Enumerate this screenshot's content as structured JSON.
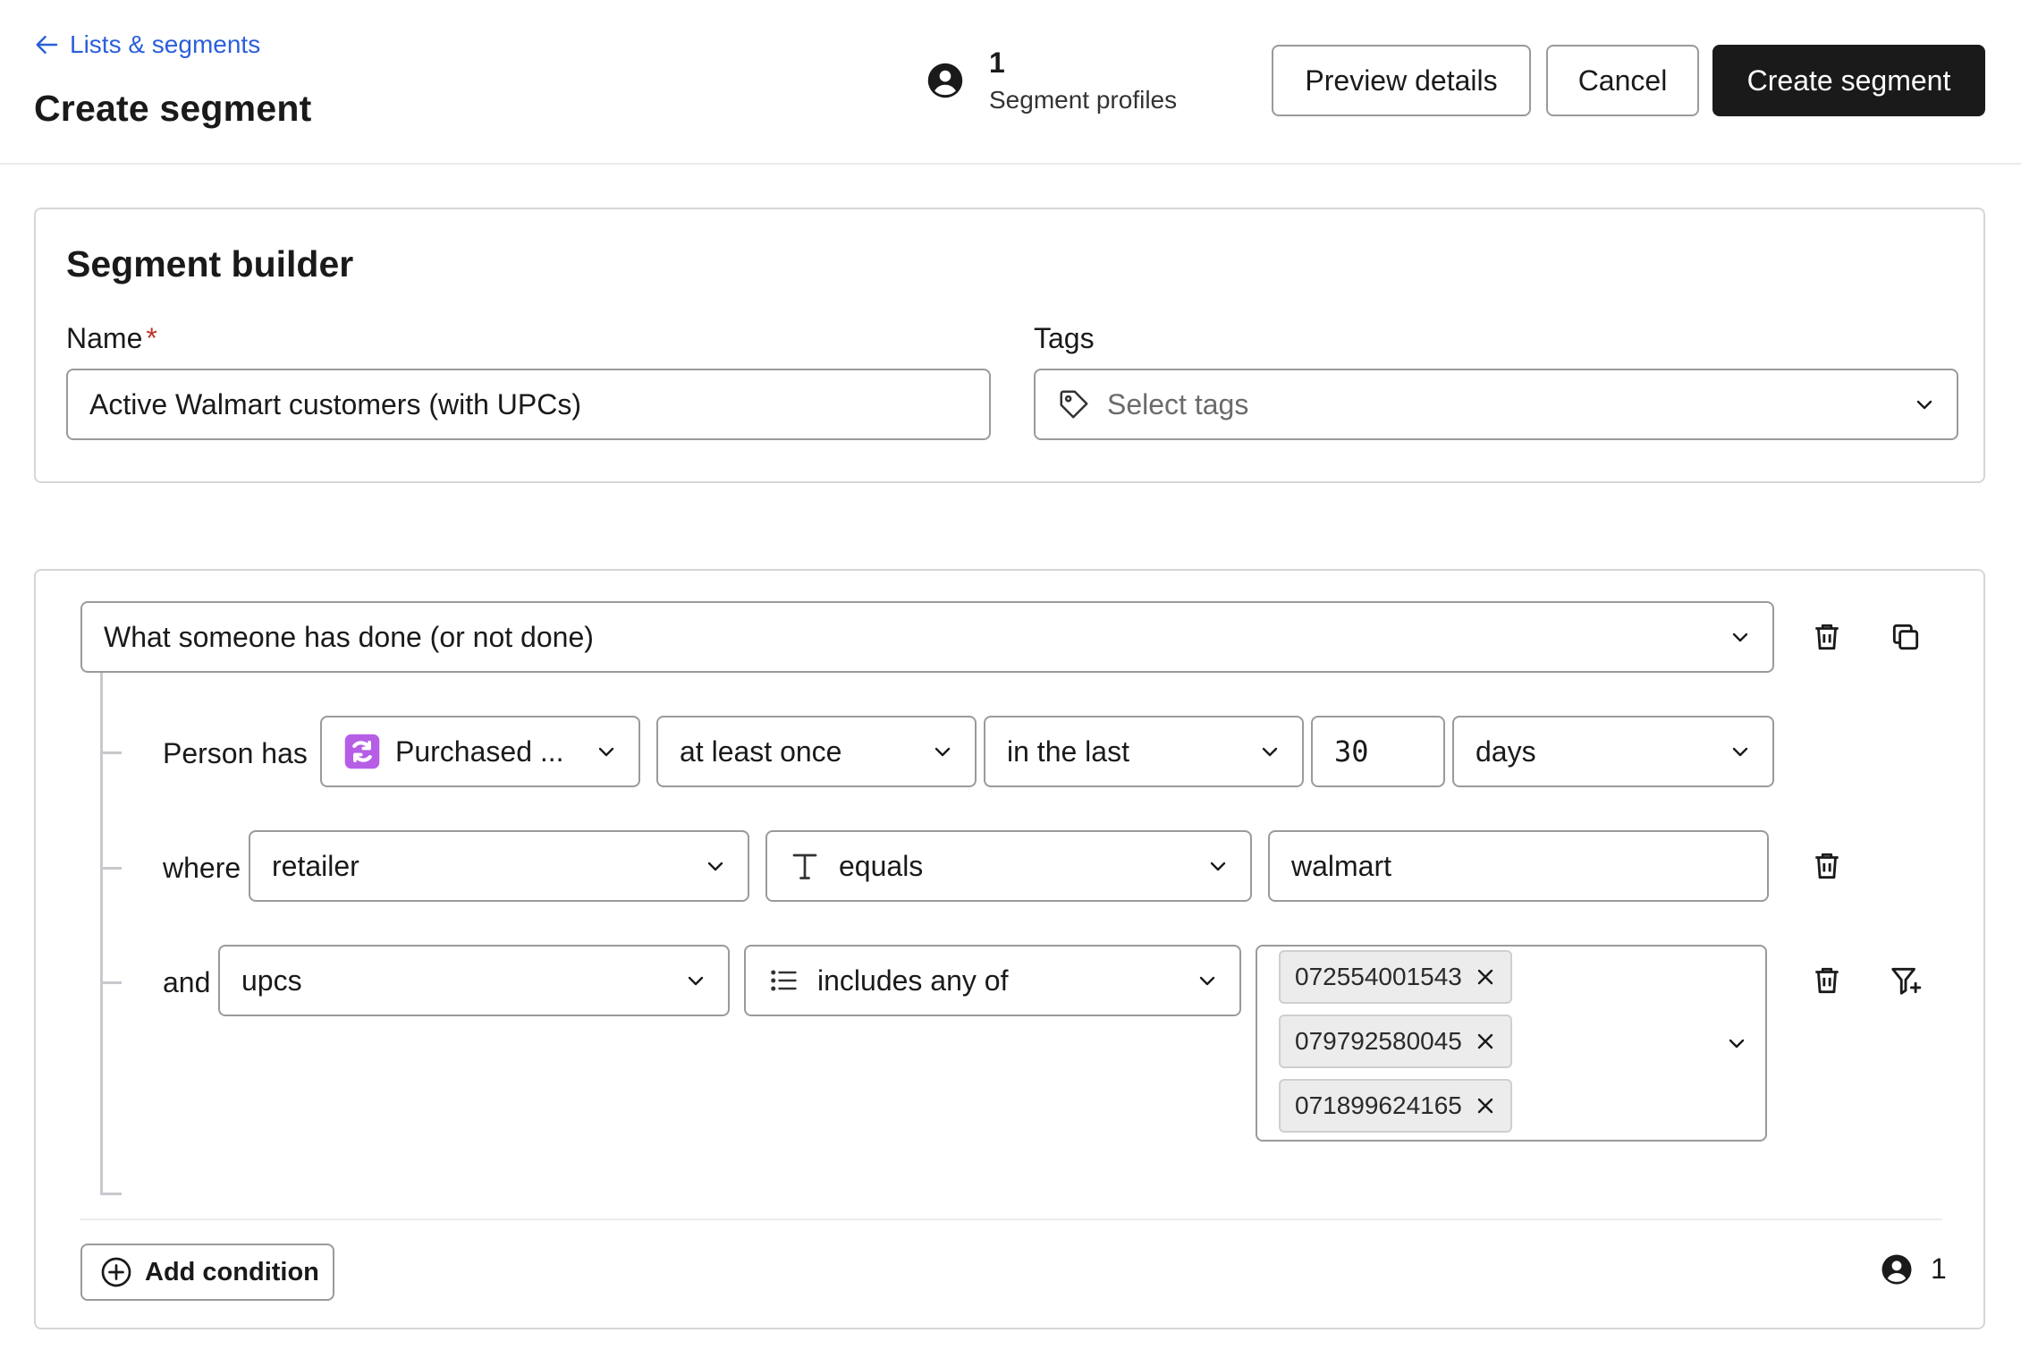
{
  "header": {
    "back_link": "Lists & segments",
    "title": "Create segment",
    "profile_count": "1",
    "profile_label": "Segment profiles",
    "buttons": {
      "preview": "Preview details",
      "cancel": "Cancel",
      "create": "Create segment"
    }
  },
  "builder": {
    "heading": "Segment builder",
    "name_label": "Name",
    "name_required_mark": "*",
    "name_value": "Active Walmart customers (with UPCs)",
    "tags_label": "Tags",
    "tags_placeholder": "Select tags"
  },
  "condition": {
    "type": "What someone has done (or not done)",
    "person_has_label": "Person has",
    "metric": "Purchased ...",
    "frequency": "at least once",
    "timeframe": "in the last",
    "timeframe_value": "30",
    "timeframe_unit": "days",
    "filter1": {
      "connector": "where",
      "property": "retailer",
      "operator": "equals",
      "value": "walmart"
    },
    "filter2": {
      "connector": "and",
      "property": "upcs",
      "operator": "includes any of",
      "values": [
        "072554001543",
        "079792580045",
        "071899624165"
      ]
    },
    "add_condition_label": "Add condition",
    "footer_count": "1"
  },
  "colors": {
    "link": "#2b5fd9",
    "primary_button": "#1a1a1a",
    "required": "#c0322b",
    "metric_icon": "#b65ee6"
  }
}
